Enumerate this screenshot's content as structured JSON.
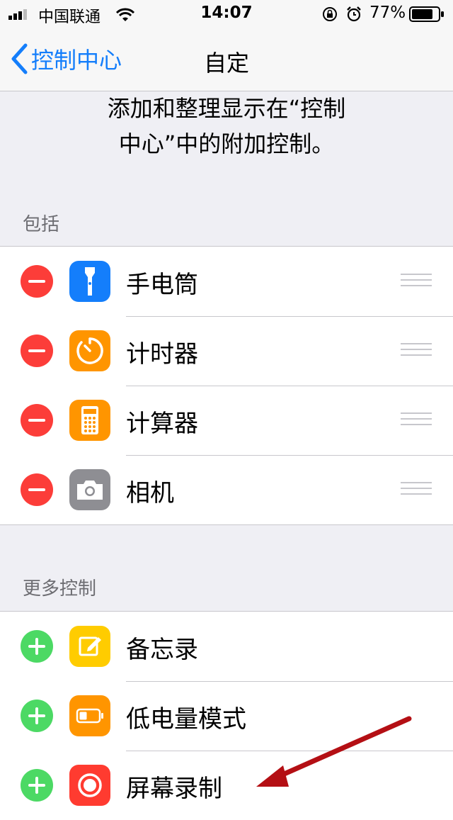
{
  "status_bar": {
    "carrier": "中国联通",
    "time": "14:07",
    "battery_percent": "77%"
  },
  "nav": {
    "back_label": "控制中心",
    "title": "自定"
  },
  "description": {
    "line1": "添加和整理显示在“控制",
    "line2": "中心”中的附加控制。"
  },
  "included": {
    "header": "包括",
    "items": [
      {
        "label": "手电筒",
        "icon": "flashlight-icon",
        "icon_color": "#147efb"
      },
      {
        "label": "计时器",
        "icon": "timer-icon",
        "icon_color": "#ff9500"
      },
      {
        "label": "计算器",
        "icon": "calculator-icon",
        "icon_color": "#ff9500"
      },
      {
        "label": "相机",
        "icon": "camera-icon",
        "icon_color": "#8e8e93"
      }
    ]
  },
  "more": {
    "header": "更多控制",
    "items": [
      {
        "label": "备忘录",
        "icon": "notes-icon",
        "icon_color": "#ffcc00"
      },
      {
        "label": "低电量模式",
        "icon": "low-power-icon",
        "icon_color": "#ff9500"
      },
      {
        "label": "屏幕录制",
        "icon": "screen-record-icon",
        "icon_color": "#ff3b30"
      }
    ]
  },
  "colors": {
    "accent": "#147efb",
    "remove": "#fc3d39",
    "add": "#4cd964",
    "annotation_arrow": "#b40f14"
  }
}
